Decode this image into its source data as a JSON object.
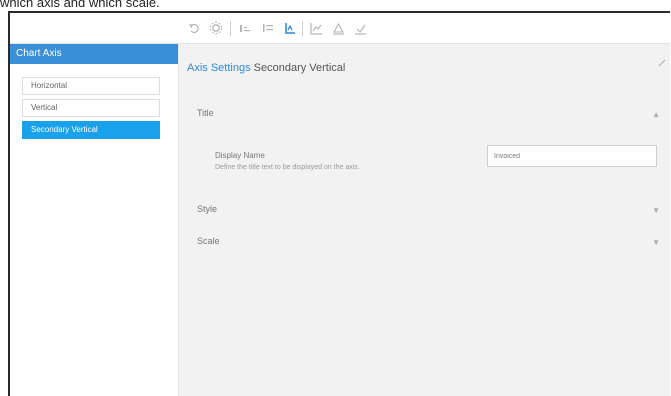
{
  "caption": "which axis and which scale.",
  "toolbar": {
    "icons": [
      "undo-icon",
      "gear-icon",
      "chart-type-icon",
      "list-icon",
      "axis-icon",
      "chart-line-icon",
      "chart-warn-icon",
      "chart-check-icon"
    ]
  },
  "sidebar": {
    "title": "Chart Axis",
    "items": [
      {
        "label": "Horizontal"
      },
      {
        "label": "Vertical"
      },
      {
        "label": "Secondary Vertical",
        "active": true
      }
    ]
  },
  "main": {
    "header_accent": "Axis Settings",
    "header_rest": "Secondary Vertical",
    "sections": [
      {
        "label": "Title",
        "toggle": "▲"
      },
      {
        "label": "Style",
        "toggle": "▼"
      },
      {
        "label": "Scale",
        "toggle": "▼"
      }
    ],
    "field": {
      "label": "Display Name",
      "description": "Define the title text to be displayed on the axis.",
      "value": "Invoiced"
    }
  },
  "colors": {
    "accent": "#3a8fd9",
    "active_item": "#1aa1ec",
    "panel_bg": "#f2f2f2"
  }
}
